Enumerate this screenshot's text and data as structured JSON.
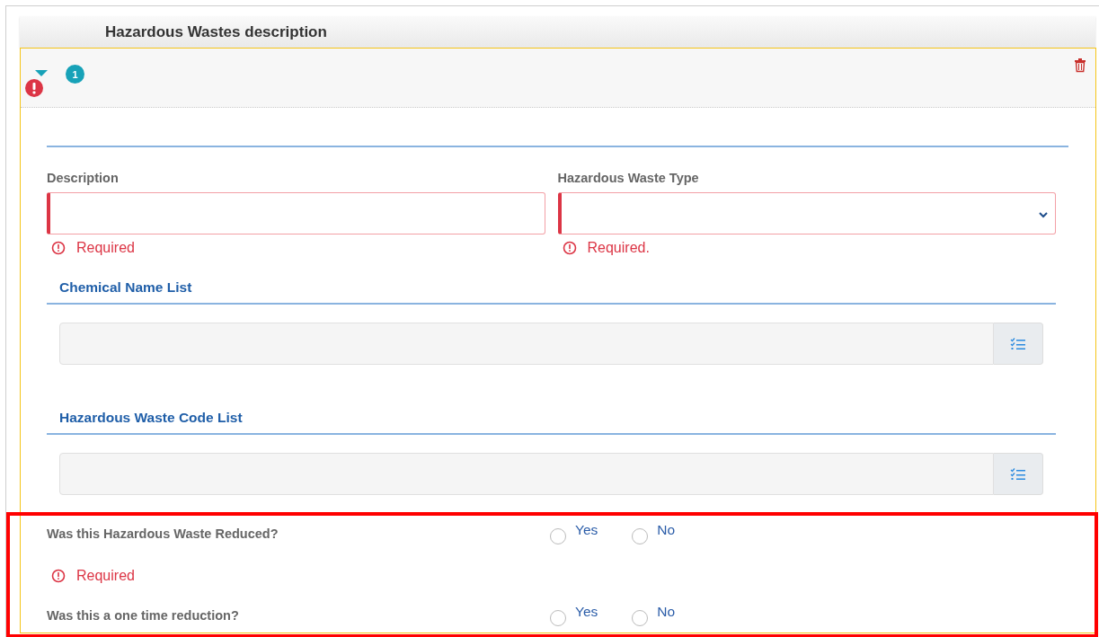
{
  "section_title": "Hazardous Wastes description",
  "item": {
    "expanded": true,
    "has_error": true,
    "badge": "1"
  },
  "fields": [
    {
      "label": "Description",
      "kind": "text",
      "error": "Required"
    },
    {
      "label": "Hazardous Waste Type",
      "kind": "select",
      "error": "Required."
    }
  ],
  "lists": [
    {
      "title": "Chemical Name List"
    },
    {
      "title": "Hazardous Waste Code List"
    }
  ],
  "questions": [
    {
      "label": "Was this Hazardous Waste Reduced?",
      "options": [
        {
          "label": "Yes",
          "selected": false
        },
        {
          "label": "No",
          "selected": false
        }
      ],
      "error": "Required"
    },
    {
      "label": "Was this a one time reduction?",
      "options": [
        {
          "label": "Yes",
          "selected": false
        },
        {
          "label": "No",
          "selected": false
        }
      ]
    }
  ]
}
